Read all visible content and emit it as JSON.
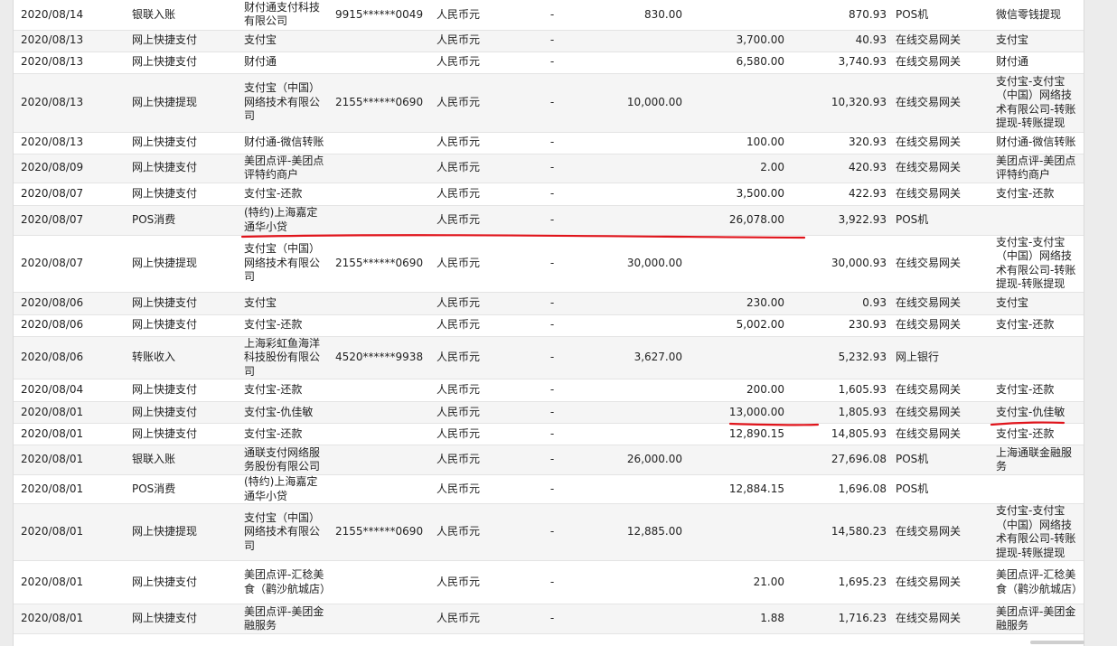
{
  "rows": [
    {
      "date": "2020/08/14",
      "type": "银联入账",
      "party": "财付通支付科技有限公司",
      "account": "9915******0049",
      "currency": "人民币元",
      "dash": "-",
      "income": "830.00",
      "expense": "",
      "balance": "870.93",
      "channel": "POS机",
      "remark": "微信零钱提现"
    },
    {
      "date": "2020/08/13",
      "type": "网上快捷支付",
      "party": "支付宝",
      "account": "",
      "currency": "人民币元",
      "dash": "-",
      "income": "",
      "expense": "3,700.00",
      "balance": "40.93",
      "channel": "在线交易网关",
      "remark": "支付宝"
    },
    {
      "date": "2020/08/13",
      "type": "网上快捷支付",
      "party": "财付通",
      "account": "",
      "currency": "人民币元",
      "dash": "-",
      "income": "",
      "expense": "6,580.00",
      "balance": "3,740.93",
      "channel": "在线交易网关",
      "remark": "财付通"
    },
    {
      "date": "2020/08/13",
      "type": "网上快捷提现",
      "party": "支付宝（中国）网络技术有限公司",
      "account": "2155******0690",
      "currency": "人民币元",
      "dash": "-",
      "income": "10,000.00",
      "expense": "",
      "balance": "10,320.93",
      "channel": "在线交易网关",
      "remark": "支付宝-支付宝（中国）网络技术有限公司-转账提现-转账提现"
    },
    {
      "date": "2020/08/13",
      "type": "网上快捷支付",
      "party": "财付通-微信转账",
      "account": "",
      "currency": "人民币元",
      "dash": "-",
      "income": "",
      "expense": "100.00",
      "balance": "320.93",
      "channel": "在线交易网关",
      "remark": "财付通-微信转账"
    },
    {
      "date": "2020/08/09",
      "type": "网上快捷支付",
      "party": "美团点评-美团点评特约商户",
      "account": "",
      "currency": "人民币元",
      "dash": "-",
      "income": "",
      "expense": "2.00",
      "balance": "420.93",
      "channel": "在线交易网关",
      "remark": "美团点评-美团点评特约商户"
    },
    {
      "date": "2020/08/07",
      "type": "网上快捷支付",
      "party": "支付宝-还款",
      "account": "",
      "currency": "人民币元",
      "dash": "-",
      "income": "",
      "expense": "3,500.00",
      "balance": "422.93",
      "channel": "在线交易网关",
      "remark": "支付宝-还款"
    },
    {
      "date": "2020/08/07",
      "type": "POS消费",
      "party": "(特约)上海嘉定通华小贷",
      "account": "",
      "currency": "人民币元",
      "dash": "-",
      "income": "",
      "expense": "26,078.00",
      "balance": "3,922.93",
      "channel": "POS机",
      "remark": ""
    },
    {
      "date": "2020/08/07",
      "type": "网上快捷提现",
      "party": "支付宝（中国）网络技术有限公司",
      "account": "2155******0690",
      "currency": "人民币元",
      "dash": "-",
      "income": "30,000.00",
      "expense": "",
      "balance": "30,000.93",
      "channel": "在线交易网关",
      "remark": "支付宝-支付宝（中国）网络技术有限公司-转账提现-转账提现"
    },
    {
      "date": "2020/08/06",
      "type": "网上快捷支付",
      "party": "支付宝",
      "account": "",
      "currency": "人民币元",
      "dash": "-",
      "income": "",
      "expense": "230.00",
      "balance": "0.93",
      "channel": "在线交易网关",
      "remark": "支付宝"
    },
    {
      "date": "2020/08/06",
      "type": "网上快捷支付",
      "party": "支付宝-还款",
      "account": "",
      "currency": "人民币元",
      "dash": "-",
      "income": "",
      "expense": "5,002.00",
      "balance": "230.93",
      "channel": "在线交易网关",
      "remark": "支付宝-还款"
    },
    {
      "date": "2020/08/06",
      "type": "转账收入",
      "party": "上海彩虹鱼海洋科技股份有限公司",
      "account": "4520******9938",
      "currency": "人民币元",
      "dash": "-",
      "income": "3,627.00",
      "expense": "",
      "balance": "5,232.93",
      "channel": "网上银行",
      "remark": ""
    },
    {
      "date": "2020/08/04",
      "type": "网上快捷支付",
      "party": "支付宝-还款",
      "account": "",
      "currency": "人民币元",
      "dash": "-",
      "income": "",
      "expense": "200.00",
      "balance": "1,605.93",
      "channel": "在线交易网关",
      "remark": "支付宝-还款"
    },
    {
      "date": "2020/08/01",
      "type": "网上快捷支付",
      "party": "支付宝-仇佳敏",
      "account": "",
      "currency": "人民币元",
      "dash": "-",
      "income": "",
      "expense": "13,000.00",
      "balance": "1,805.93",
      "channel": "在线交易网关",
      "remark": "支付宝-仇佳敏"
    },
    {
      "date": "2020/08/01",
      "type": "网上快捷支付",
      "party": "支付宝-还款",
      "account": "",
      "currency": "人民币元",
      "dash": "-",
      "income": "",
      "expense": "12,890.15",
      "balance": "14,805.93",
      "channel": "在线交易网关",
      "remark": "支付宝-还款"
    },
    {
      "date": "2020/08/01",
      "type": "银联入账",
      "party": "通联支付网络服务股份有限公司",
      "account": "",
      "currency": "人民币元",
      "dash": "-",
      "income": "26,000.00",
      "expense": "",
      "balance": "27,696.08",
      "channel": "POS机",
      "remark": "上海通联金融服务"
    },
    {
      "date": "2020/08/01",
      "type": "POS消费",
      "party": "(特约)上海嘉定通华小贷",
      "account": "",
      "currency": "人民币元",
      "dash": "-",
      "income": "",
      "expense": "12,884.15",
      "balance": "1,696.08",
      "channel": "POS机",
      "remark": ""
    },
    {
      "date": "2020/08/01",
      "type": "网上快捷提现",
      "party": "支付宝（中国）网络技术有限公司",
      "account": "2155******0690",
      "currency": "人民币元",
      "dash": "-",
      "income": "12,885.00",
      "expense": "",
      "balance": "14,580.23",
      "channel": "在线交易网关",
      "remark": "支付宝-支付宝（中国）网络技术有限公司-转账提现-转账提现"
    },
    {
      "date": "2020/08/01",
      "type": "网上快捷支付",
      "party": "美团点评-汇稔美食（鹳沙航城店）",
      "account": "",
      "currency": "人民币元",
      "dash": "-",
      "income": "",
      "expense": "21.00",
      "balance": "1,695.23",
      "channel": "在线交易网关",
      "remark": "美团点评-汇稔美食（鹳沙航城店）"
    },
    {
      "date": "2020/08/01",
      "type": "网上快捷支付",
      "party": "美团点评-美团金融服务",
      "account": "",
      "currency": "人民币元",
      "dash": "-",
      "income": "",
      "expense": "1.88",
      "balance": "1,716.23",
      "channel": "在线交易网关",
      "remark": "美团点评-美团金融服务"
    }
  ],
  "annotation_color": "#e0141b"
}
